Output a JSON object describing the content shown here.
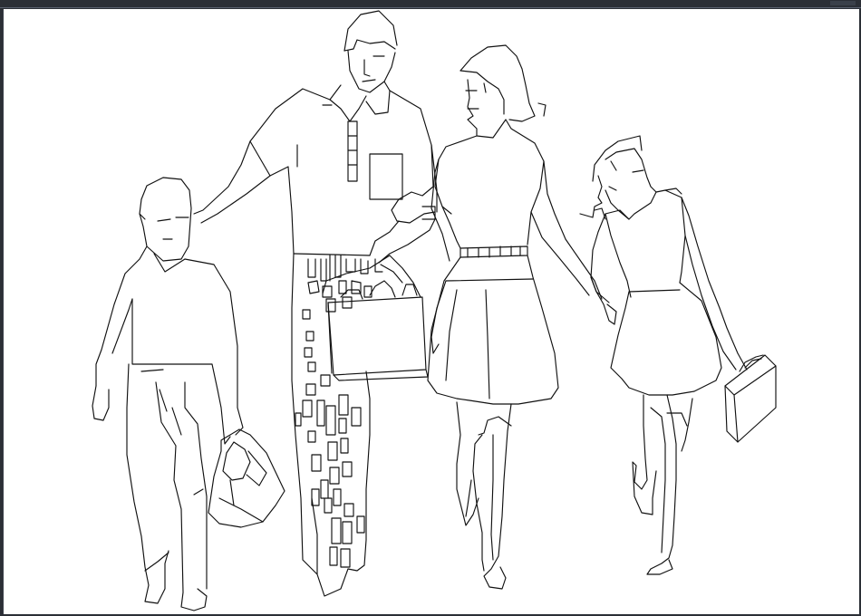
{
  "window": {
    "background_color": "#2b2f36",
    "canvas_color": "#ffffff",
    "line_color": "#111111"
  },
  "drawing": {
    "subject_icons": [
      "boy-figure",
      "father-figure",
      "mother-figure",
      "girl-figure",
      "duffel-bag-icon",
      "shopping-basket-icon",
      "handbag-icon"
    ]
  }
}
